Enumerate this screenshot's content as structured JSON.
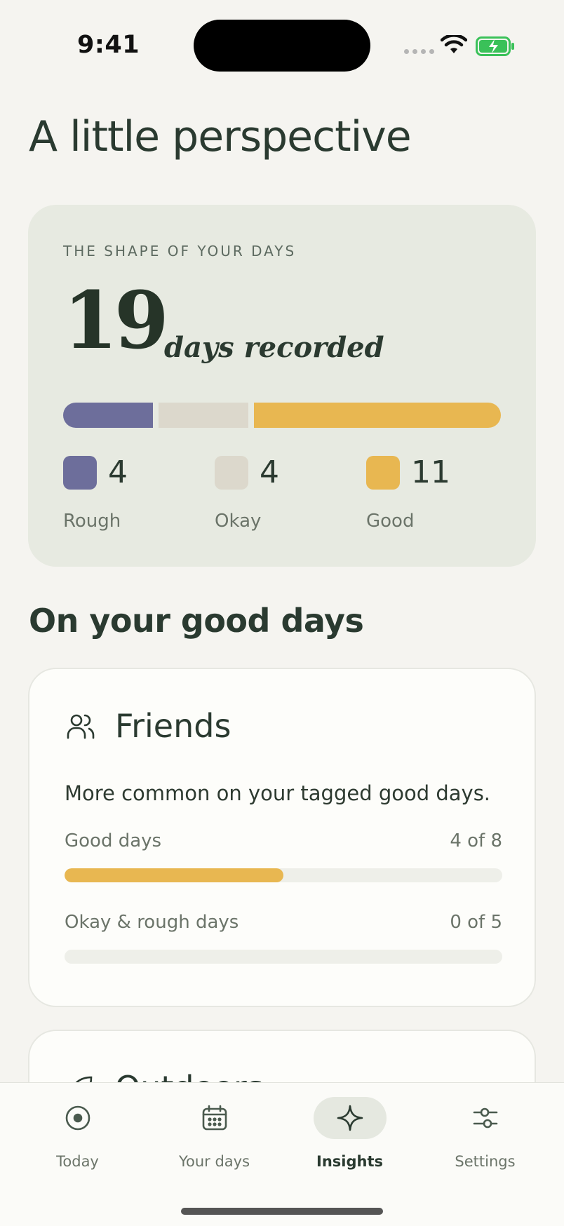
{
  "status": {
    "time": "9:41"
  },
  "page": {
    "title": "A little perspective"
  },
  "shape_card": {
    "eyebrow": "THE SHAPE OF YOUR DAYS",
    "count": "19",
    "count_label": "days recorded",
    "legend": [
      {
        "value": "4",
        "label": "Rough",
        "color": "#6d6e9b"
      },
      {
        "value": "4",
        "label": "Okay",
        "color": "#dcd8cc"
      },
      {
        "value": "11",
        "label": "Good",
        "color": "#e8b751"
      }
    ]
  },
  "good_days_section": {
    "title": "On your good days",
    "cards": [
      {
        "icon": "friends-icon",
        "title": "Friends",
        "description": "More common on your tagged good days.",
        "metrics": [
          {
            "label": "Good days",
            "value": "4 of 8",
            "fraction": 0.5
          },
          {
            "label": "Okay & rough days",
            "value": "0 of 5",
            "fraction": 0.0
          }
        ]
      },
      {
        "icon": "outdoors-icon",
        "title": "Outdoors"
      }
    ]
  },
  "tab_bar": {
    "tabs": [
      {
        "label": "Today",
        "icon": "record-icon",
        "active": false
      },
      {
        "label": "Your days",
        "icon": "calendar-icon",
        "active": false
      },
      {
        "label": "Insights",
        "icon": "sparkle-icon",
        "active": true
      },
      {
        "label": "Settings",
        "icon": "sliders-icon",
        "active": false
      }
    ]
  }
}
